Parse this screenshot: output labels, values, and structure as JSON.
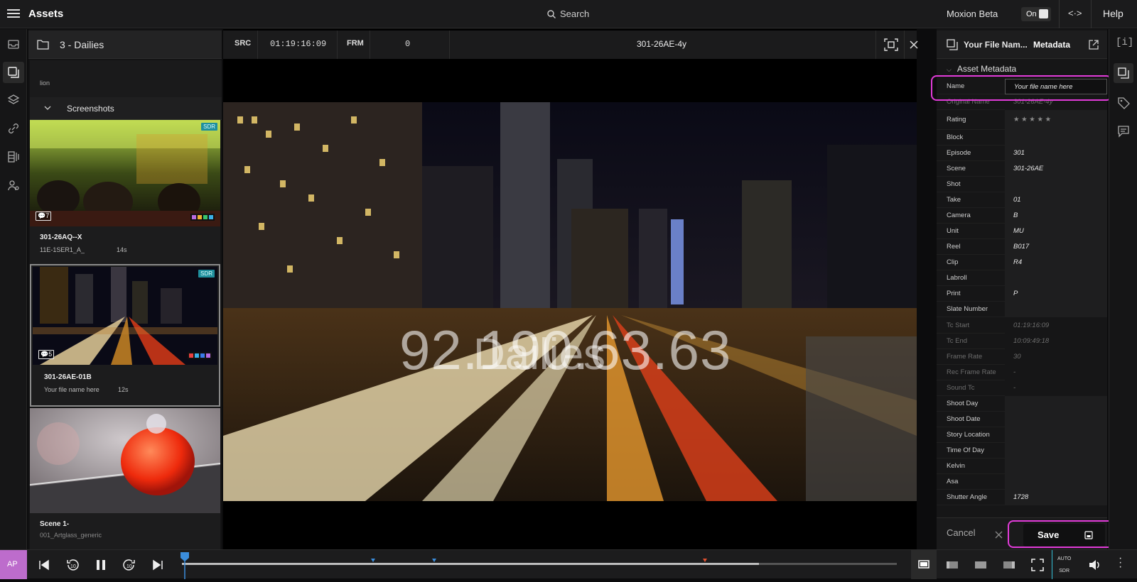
{
  "topbar": {
    "title": "Assets",
    "search": "Search",
    "beta": "Moxion Beta",
    "toggle": "On",
    "help": "Help"
  },
  "assets": {
    "folder": "3 - Dailies",
    "filter_text": "lion",
    "group": "Screenshots",
    "cards": [
      {
        "name": "301-26AQ--X",
        "sub": "11E-1SER1_A_",
        "duration": "14s",
        "comments": "7",
        "badge": "SDR"
      },
      {
        "name": "301-26AE-01B",
        "sub": "Your file name here",
        "duration": "12s",
        "comments": "5",
        "badge": "SDR"
      },
      {
        "name": "Scene 1-",
        "sub": "001_Artglass_generic"
      }
    ]
  },
  "viewer": {
    "src_label": "SRC",
    "timecode": "01:19:16:09",
    "frm_label": "FRM",
    "frame": "0",
    "clip_title": "301-26AE-4y",
    "watermark_ip": "92.190.63.63",
    "watermark_text": "Dailies"
  },
  "metadata": {
    "file_name": "Your File Nam...",
    "tab": "Metadata",
    "section": "Asset Metadata",
    "rows": [
      {
        "k": "Name",
        "v": "Your file name here",
        "ro": false
      },
      {
        "k": "Original Name",
        "v": "301-26AE-4y",
        "ro": true
      },
      {
        "k": "Rating",
        "v": "★ ★ ★ ★ ★",
        "ro": false
      },
      {
        "k": "Block",
        "v": "",
        "ro": false
      },
      {
        "k": "Episode",
        "v": "301",
        "ro": false
      },
      {
        "k": "Scene",
        "v": "301-26AE",
        "ro": false
      },
      {
        "k": "Shot",
        "v": "",
        "ro": false
      },
      {
        "k": "Take",
        "v": "01",
        "ro": false
      },
      {
        "k": "Camera",
        "v": "B",
        "ro": false
      },
      {
        "k": "Unit",
        "v": "MU",
        "ro": false
      },
      {
        "k": "Reel",
        "v": "B017",
        "ro": false
      },
      {
        "k": "Clip",
        "v": "R4",
        "ro": false
      },
      {
        "k": "Labroll",
        "v": "",
        "ro": false
      },
      {
        "k": "Print",
        "v": "P",
        "ro": false
      },
      {
        "k": "Slate Number",
        "v": "",
        "ro": false
      },
      {
        "k": "Tc Start",
        "v": "01:19:16:09",
        "ro": true
      },
      {
        "k": "Tc End",
        "v": "10:09:49:18",
        "ro": true
      },
      {
        "k": "Frame Rate",
        "v": "30",
        "ro": true
      },
      {
        "k": "Rec Frame Rate",
        "v": "-",
        "ro": true
      },
      {
        "k": "Sound Tc",
        "v": "-",
        "ro": true
      },
      {
        "k": "Shoot Day",
        "v": "",
        "ro": false
      },
      {
        "k": "Shoot Date",
        "v": "",
        "ro": false
      },
      {
        "k": "Story Location",
        "v": "",
        "ro": false
      },
      {
        "k": "Time Of Day",
        "v": "",
        "ro": false
      },
      {
        "k": "Kelvin",
        "v": "",
        "ro": false
      },
      {
        "k": "Asa",
        "v": "",
        "ro": false
      },
      {
        "k": "Shutter Angle",
        "v": "1728",
        "ro": false
      }
    ],
    "cancel": "Cancel",
    "save": "Save"
  },
  "bottom": {
    "avatar": "AP",
    "auto": "AUTO",
    "sdr": "SDR",
    "progress": 0.807
  },
  "colors": {
    "accent": "#e23bd9",
    "avatar": "#bd6ccc",
    "sdr_badge": "#1f8f9d"
  }
}
